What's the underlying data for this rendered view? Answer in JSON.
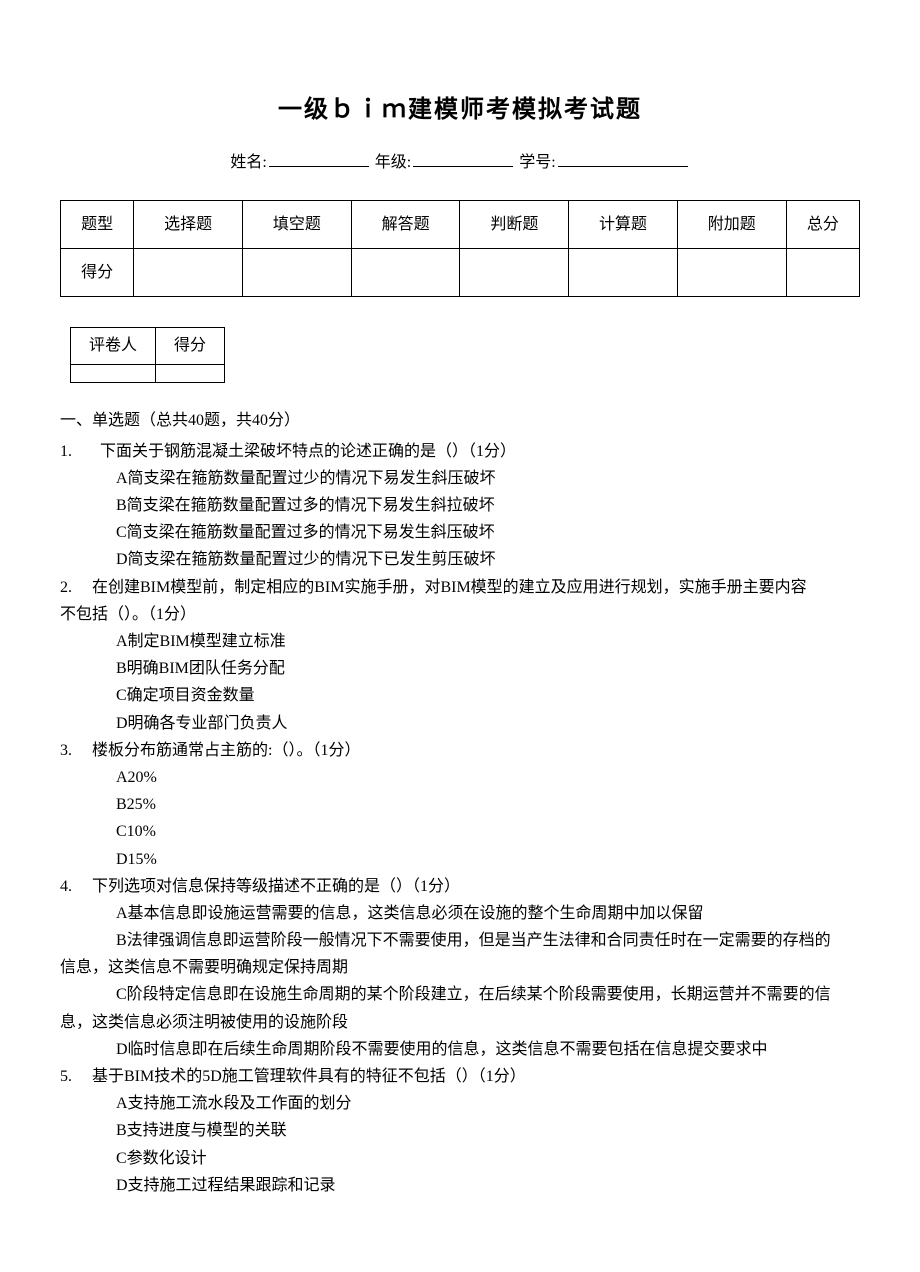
{
  "title": "一级ｂｉｍ建模师考模拟考试题",
  "info": {
    "name_label": "姓名:",
    "grade_label": "年级:",
    "id_label": "学号:"
  },
  "score_table": {
    "headers": [
      "题型",
      "选择题",
      "填空题",
      "解答题",
      "判断题",
      "计算题",
      "附加题",
      "总分"
    ],
    "row_label": "得分"
  },
  "grader_table": {
    "c1": "评卷人",
    "c2": "得分"
  },
  "section1_title": "一、单选题（总共40题，共40分）",
  "q1": {
    "num": "1.",
    "stem": "下面关于钢筋混凝土梁破坏特点的论述正确的是（）（1分）",
    "a": "A简支梁在箍筋数量配置过少的情况下易发生斜压破坏",
    "b": "B简支梁在箍筋数量配置过多的情况下易发生斜拉破坏",
    "c": "C简支梁在箍筋数量配置过多的情况下易发生斜压破坏",
    "d": "D简支梁在箍筋数量配置过少的情况下已发生剪压破坏"
  },
  "q2": {
    "num": "2.",
    "stem": "在创建BIM模型前，制定相应的BIM实施手册，对BIM模型的建立及应用进行规划，实施手册主要内容",
    "stem2": "不包括（）。（1分）",
    "a": "A制定BIM模型建立标准",
    "b": "B明确BIM团队任务分配",
    "c": "C确定项目资金数量",
    "d": "D明确各专业部门负责人"
  },
  "q3": {
    "num": "3.",
    "stem": "楼板分布筋通常占主筋的:（）。（1分）",
    "a": "A20%",
    "b": "B25%",
    "c": "C10%",
    "d": "D15%"
  },
  "q4": {
    "num": "4.",
    "stem": "下列选项对信息保持等级描述不正确的是（）（1分）",
    "a": "A基本信息即设施运营需要的信息，这类信息必须在设施的整个生命周期中加以保留",
    "b": "B法律强调信息即运营阶段一般情况下不需要使用，但是当产生法律和合同责任时在一定需要的存档的",
    "b2": "信息，这类信息不需要明确规定保持周期",
    "c": "C阶段特定信息即在设施生命周期的某个阶段建立，在后续某个阶段需要使用，长期运营并不需要的信",
    "c2": "息，这类信息必须注明被使用的设施阶段",
    "d": "D临时信息即在后续生命周期阶段不需要使用的信息，这类信息不需要包括在信息提交要求中"
  },
  "q5": {
    "num": "5.",
    "stem": "基于BIM技术的5D施工管理软件具有的特征不包括（）（1分）",
    "a": "A支持施工流水段及工作面的划分",
    "b": "B支持进度与模型的关联",
    "c": "C参数化设计",
    "d": "D支持施工过程结果跟踪和记录"
  }
}
